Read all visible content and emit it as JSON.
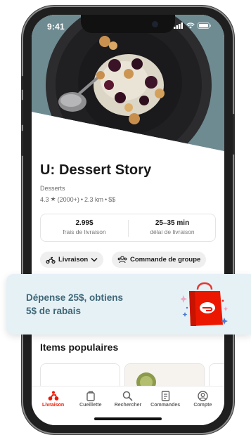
{
  "status_bar": {
    "time": "9:41"
  },
  "store": {
    "name": "U: Dessert Story",
    "category": "Desserts",
    "rating": "4.3",
    "reviews": "(2000+)",
    "distance": "2.3 km",
    "price_level": "$$",
    "separator": "•"
  },
  "delivery_info": {
    "fee_value": "2.99$",
    "fee_label": "frais de livraison",
    "time_value": "25–35 min",
    "time_label": "délai de livraison"
  },
  "actions": {
    "delivery_label": "Livraison",
    "group_order_label": "Commande de groupe"
  },
  "promo": {
    "line1": "Dépense 25$, obtiens",
    "line2": "5$ de rabais"
  },
  "popular": {
    "title": "Items populaires"
  },
  "tabs": [
    {
      "label": "Livraison",
      "icon": "delivery-icon",
      "active": true
    },
    {
      "label": "Cueillette",
      "icon": "pickup-icon",
      "active": false
    },
    {
      "label": "Rechercher",
      "icon": "search-icon",
      "active": false
    },
    {
      "label": "Commandes",
      "icon": "orders-icon",
      "active": false
    },
    {
      "label": "Compte",
      "icon": "account-icon",
      "active": false
    }
  ],
  "colors": {
    "accent": "#eb1700",
    "promo_bg": "#e6f1f6",
    "promo_text": "#3f6777"
  }
}
